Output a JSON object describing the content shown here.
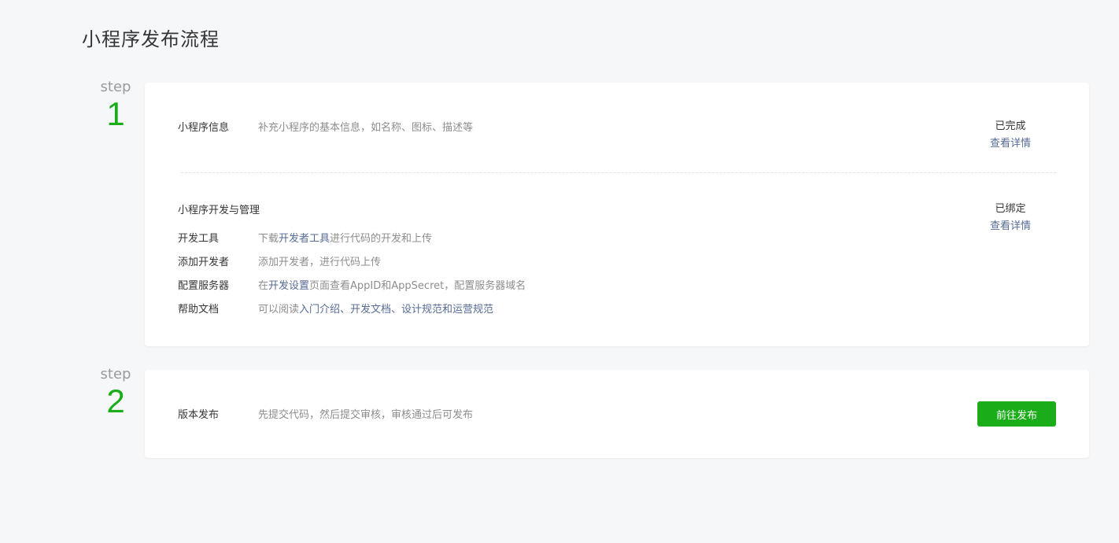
{
  "page": {
    "title": "小程序发布流程"
  },
  "steps": [
    {
      "label": "step",
      "number": "1",
      "info": {
        "title": "小程序信息",
        "desc": "补充小程序的基本信息，如名称、图标、描述等",
        "status": "已完成",
        "link": "查看详情"
      },
      "dev": {
        "title": "小程序开发与管理",
        "status": "已绑定",
        "link": "查看详情",
        "items": [
          {
            "label": "开发工具",
            "pre": "下载",
            "link": "开发者工具",
            "post": "进行代码的开发和上传"
          },
          {
            "label": "添加开发者",
            "pre": "添加开发者，进行代码上传",
            "link": "",
            "post": ""
          },
          {
            "label": "配置服务器",
            "pre": "在",
            "link": "开发设置",
            "post": "页面查看AppID和AppSecret，配置服务器域名"
          },
          {
            "label": "帮助文档",
            "pre": "可以阅读",
            "link": "入门介绍、开发文档、设计规范和运营规范",
            "post": ""
          }
        ]
      }
    },
    {
      "label": "step",
      "number": "2",
      "release": {
        "title": "版本发布",
        "desc": "先提交代码，然后提交审核，审核通过后可发布",
        "button": "前往发布"
      }
    }
  ],
  "colors": {
    "accent": "#1aad19",
    "link": "#576b95",
    "background": "#f6f7f9"
  }
}
